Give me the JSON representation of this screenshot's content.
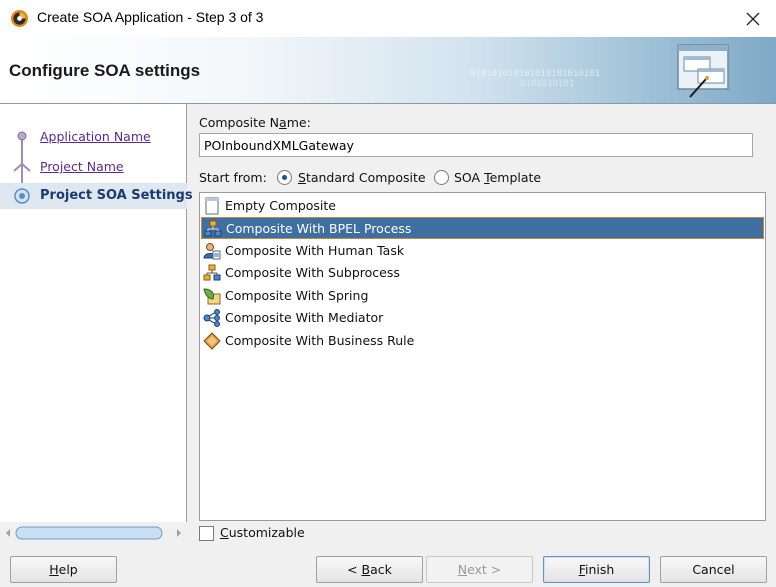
{
  "window": {
    "title": "Create SOA Application - Step 3 of 3",
    "close_icon": "close-icon",
    "app_icon": "jdeveloper-icon"
  },
  "banner": {
    "title": "Configure SOA settings",
    "binary_text_1": "010101010101010101010101",
    "binary_text_2": "0101010101"
  },
  "nav": {
    "items": [
      {
        "label": "Application Name",
        "state": "visited"
      },
      {
        "label": "Project Name",
        "state": "visited"
      },
      {
        "label": "Project SOA Settings",
        "state": "current"
      }
    ]
  },
  "form": {
    "composite_name_label_pre": "Composite N",
    "composite_name_label_mn": "a",
    "composite_name_label_post": "me:",
    "composite_name_value": "POInboundXMLGateway",
    "start_from_label": "Start from:",
    "start_options": [
      {
        "label_mn": "S",
        "label_rest": "tandard Composite",
        "selected": true
      },
      {
        "label_pre": "SOA ",
        "label_mn": "T",
        "label_rest": "emplate",
        "selected": false
      }
    ],
    "templates": [
      {
        "label": "Empty Composite",
        "icon": "empty-composite-icon"
      },
      {
        "label": "Composite With BPEL Process",
        "icon": "bpel-process-icon",
        "selected": true
      },
      {
        "label": "Composite With Human Task",
        "icon": "human-task-icon"
      },
      {
        "label": "Composite With Subprocess",
        "icon": "subprocess-icon"
      },
      {
        "label": "Composite With Spring",
        "icon": "spring-icon"
      },
      {
        "label": "Composite With Mediator",
        "icon": "mediator-icon"
      },
      {
        "label": "Composite With Business Rule",
        "icon": "business-rule-icon"
      }
    ],
    "customizable_label_mn": "C",
    "customizable_label_rest": "ustomizable",
    "customizable_checked": false
  },
  "buttons": {
    "help_mn": "H",
    "help_rest": "elp",
    "back_pre": "< ",
    "back_mn": "B",
    "back_rest": "ack",
    "next_mn": "N",
    "next_rest": "ext >",
    "finish_mn": "F",
    "finish_rest": "inish",
    "cancel": "Cancel"
  },
  "colors": {
    "selection_bg": "#3f6fa0",
    "nav_link": "#5b2a86",
    "nav_current": "#1b3a6e"
  }
}
